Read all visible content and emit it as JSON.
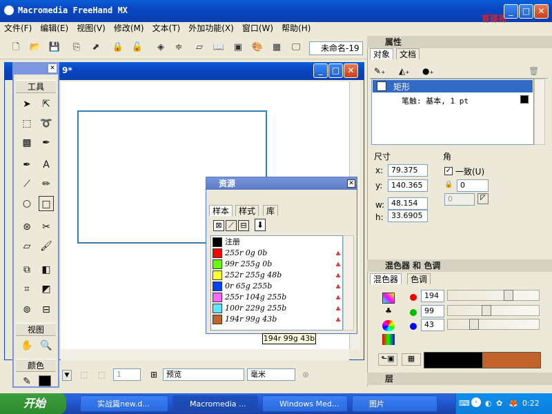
{
  "window": {
    "title": "Macromedia FreeHand MX",
    "logo_text": "育碟苑"
  },
  "menu": [
    "文件(F)",
    "编辑(E)",
    "视图(V)",
    "修改(M)",
    "文本(T)",
    "外加功能(X)",
    "窗口(W)",
    "帮助(H)"
  ],
  "toolbar": {
    "document_name": "未命名-19"
  },
  "doc_window": {
    "title_suffix": "9*"
  },
  "tools_panel": {
    "title": "工具",
    "section_view": "视图",
    "section_color": "颜色"
  },
  "status_bar": {
    "page_number": "1",
    "view_mode": "预览",
    "units": "毫米"
  },
  "assets_panel": {
    "title": "资源",
    "tabs": [
      "样本",
      "样式",
      "库"
    ],
    "swatches": [
      {
        "name": "注册",
        "color": "#000000"
      },
      {
        "name": "255r 0g 0b",
        "color": "#ff0000"
      },
      {
        "name": "99r 255g 0b",
        "color": "#63ff00"
      },
      {
        "name": "252r 255g 48b",
        "color": "#fcff30"
      },
      {
        "name": "0r 65g 255b",
        "color": "#0041ff"
      },
      {
        "name": "255r 104g 255b",
        "color": "#ff68ff"
      },
      {
        "name": "100r 229g 255b",
        "color": "#64e5ff"
      },
      {
        "name": "194r 99g 43b",
        "color": "#c2632b"
      }
    ],
    "tooltip": "194r 99g 43b"
  },
  "properties_panel": {
    "title": "属性",
    "tabs": [
      "对象",
      "文档"
    ],
    "object_name": "矩形",
    "stroke": "笔触: 基本, 1 pt",
    "size_label": "尺寸",
    "corner_label": "角",
    "x_label": "x:",
    "x": "79.375",
    "y_label": "y:",
    "y": "140.365",
    "w_label": "w:",
    "w": "48.154",
    "h_label": "h:",
    "h": "33.6905",
    "uniform_label": "一致(U)",
    "corner_value": "0",
    "corner_disabled": "0"
  },
  "mixer_panel": {
    "title": "混色器 和 色调",
    "tabs": [
      "混色器",
      "色调"
    ],
    "r": "194",
    "g": "99",
    "b": "43",
    "preview_old": "#000000",
    "preview_new": "#c2632b"
  },
  "layers_panel": {
    "title": "层"
  },
  "taskbar": {
    "start": "开始",
    "tasks": [
      "实战篇new.d...",
      "Macromedia ...",
      "Windows Med...",
      "图片"
    ],
    "clock": "0:22"
  }
}
